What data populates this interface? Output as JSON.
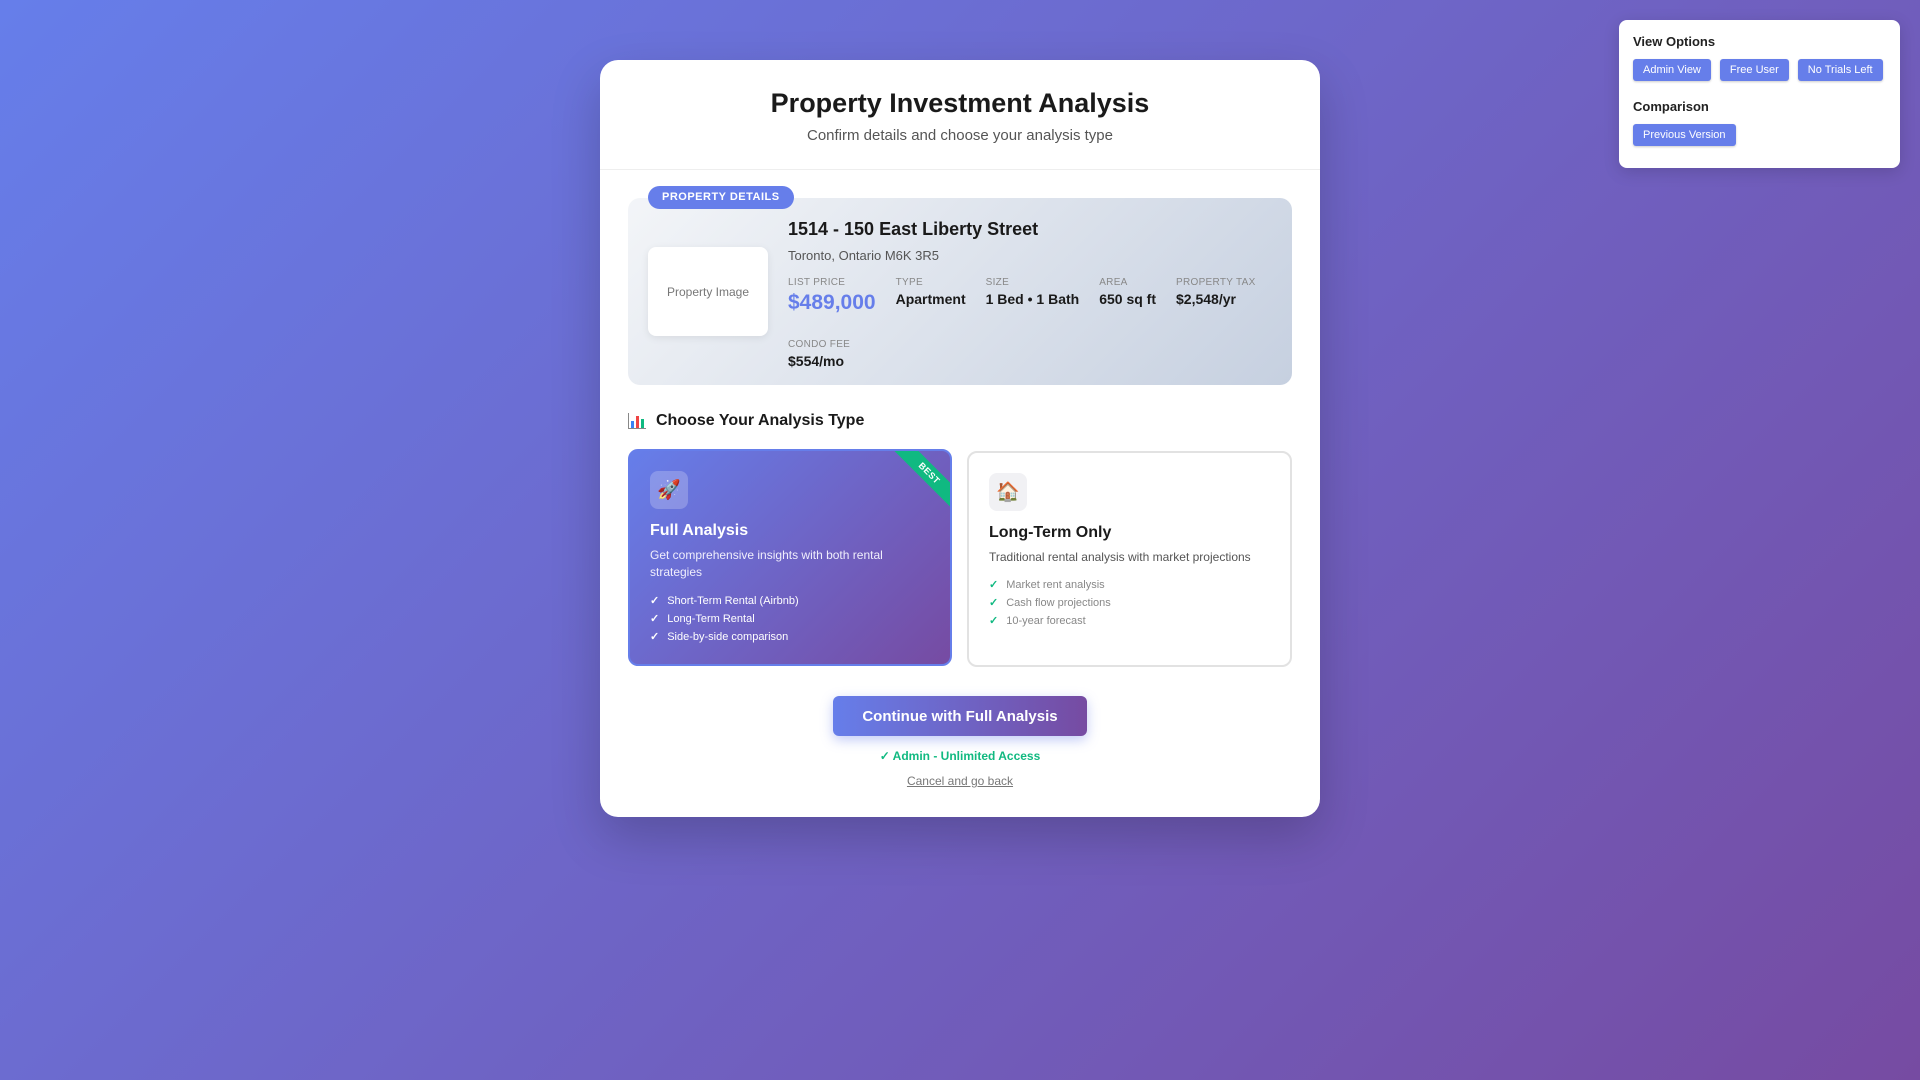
{
  "view_options": {
    "title": "View Options",
    "buttons": [
      "Admin View",
      "Free User",
      "No Trials Left"
    ],
    "comparison_title": "Comparison",
    "comparison_button": "Previous Version"
  },
  "header": {
    "title": "Property Investment Analysis",
    "subtitle": "Confirm details and choose your analysis type"
  },
  "property": {
    "badge": "PROPERTY DETAILS",
    "image_placeholder": "Property Image",
    "address": "1514 - 150 East Liberty Street",
    "city": "Toronto, Ontario M6K 3R5",
    "stats": [
      {
        "label": "LIST PRICE",
        "value": "$489,000"
      },
      {
        "label": "TYPE",
        "value": "Apartment"
      },
      {
        "label": "SIZE",
        "value": "1 Bed • 1 Bath"
      },
      {
        "label": "AREA",
        "value": "650 sq ft"
      },
      {
        "label": "PROPERTY TAX",
        "value": "$2,548/yr"
      },
      {
        "label": "CONDO FEE",
        "value": "$554/mo"
      }
    ]
  },
  "analysis": {
    "title": "Choose Your Analysis Type",
    "options": [
      {
        "icon": "rocket-icon",
        "title": "Full Analysis",
        "ribbon": "BEST",
        "description": "Get comprehensive insights with both rental strategies",
        "features": [
          "Short-Term Rental (Airbnb)",
          "Long-Term Rental",
          "Side-by-side comparison"
        ]
      },
      {
        "icon": "house-icon",
        "title": "Long-Term Only",
        "description": "Traditional rental analysis with market projections",
        "features": [
          "Market rent analysis",
          "Cash flow projections",
          "10-year forecast"
        ]
      }
    ]
  },
  "actions": {
    "continue_label": "Continue with Full Analysis",
    "access_text": "✓ Admin - Unlimited Access",
    "cancel_label": "Cancel and go back"
  },
  "colors": {
    "accent": "#667eea",
    "accent_dark": "#764ba2",
    "success": "#10b981"
  }
}
